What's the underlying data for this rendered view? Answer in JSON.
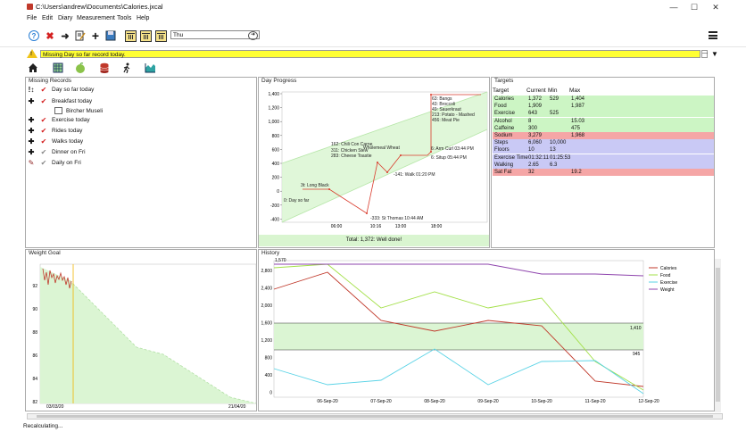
{
  "window": {
    "title": "C:\\Users\\andrew\\Documents\\Calories.jxcal",
    "minimize": "—",
    "maximize": "☐",
    "close": "✕"
  },
  "menu": [
    "File",
    "Edit",
    "Diary",
    "Measurement",
    "Tools",
    "Help"
  ],
  "toolbar": {
    "day_field": "Thu",
    "go_icon": "arrow-right-circle-icon"
  },
  "warning": {
    "text": "Missing Day so far record today."
  },
  "missing_records": {
    "title": "Missing Records",
    "items": [
      {
        "icon": "exclamation-icon",
        "label": "Day so far today"
      },
      {
        "icon": "plus-icon",
        "label": "Breakfast today"
      },
      {
        "icon": "plus-icon",
        "label": "Exercise today"
      },
      {
        "icon": "plus-icon",
        "label": "Rides today"
      },
      {
        "icon": "plus-icon",
        "label": "Walks today"
      },
      {
        "icon": "plus-icon",
        "label": "Dinner on Fri"
      },
      {
        "icon": "edit-icon",
        "label": "Daily on Fri"
      }
    ],
    "subitem": "Bircher Museli"
  },
  "day_progress": {
    "title": "Day Progress",
    "total_text": "Total: 1,372: Well done!",
    "yticks": [
      "1,400",
      "1,200",
      "1,000",
      "800",
      "600",
      "400",
      "200",
      "0",
      "-200",
      "-400"
    ],
    "xticks": [
      "06:00",
      "10:16",
      "13:00",
      "18:00"
    ],
    "annotations": [
      "0: Day so far",
      "3t: Long Black",
      "162: Chili Con Carne",
      "311: Chicken Stew",
      "283: Cheese Toastie",
      "Wholemeal Wheat",
      "-333: St Thomas 10:44 AM",
      "-141: Walk 01:20 PM",
      "6: Arm Curl 03:44 PM",
      "6: Situp 05:44 PM",
      "63: Bangs",
      "43: Broccoli",
      "49: Sauerkraut",
      "213: Potato - Mashed",
      "456: Meat Pie"
    ]
  },
  "targets": {
    "title": "Targets",
    "headers": [
      "Target",
      "Current",
      "Min",
      "Max"
    ],
    "rows": [
      {
        "name": "Calories",
        "current": "1,372",
        "min": "529",
        "max": "1,404",
        "status": "ok"
      },
      {
        "name": "Food",
        "current": "1,909",
        "min": "",
        "max": "1,987",
        "status": "ok"
      },
      {
        "name": "Exercise",
        "current": "643",
        "min": "525",
        "max": "",
        "status": "ok"
      },
      {
        "name": "Alcohol",
        "current": "8",
        "min": "",
        "max": "15.03",
        "status": "ok"
      },
      {
        "name": "Caffeine",
        "current": "300",
        "min": "",
        "max": "475",
        "status": "ok"
      },
      {
        "name": "Sodium",
        "current": "3,279",
        "min": "",
        "max": "1,968",
        "status": "over"
      },
      {
        "name": "Steps",
        "current": "6,060",
        "min": "10,000",
        "max": "",
        "status": "under"
      },
      {
        "name": "Floors",
        "current": "10",
        "min": "13",
        "max": "",
        "status": "under"
      },
      {
        "name": "Exercise Time",
        "current": "01:32:11",
        "min": "01:25:53",
        "max": "",
        "status": "under"
      },
      {
        "name": "Walking",
        "current": "2.65",
        "min": "6.3",
        "max": "",
        "status": "under"
      },
      {
        "name": "Sat Fat",
        "current": "32",
        "min": "",
        "max": "19.2",
        "status": "over"
      }
    ],
    "colors": {
      "ok": "#ccf5c4",
      "over": "#f5a6a6",
      "under": "#c9c9f5"
    }
  },
  "weight_goal": {
    "title": "Weight Goal",
    "yticks": [
      "92",
      "90",
      "88",
      "86",
      "84",
      "82"
    ],
    "xticks": [
      "03/03/20",
      "21/04/20"
    ]
  },
  "history": {
    "title": "History",
    "yticks": [
      "2,800",
      "2,400",
      "2,000",
      "1,600",
      "1,200",
      "800",
      "400",
      "0"
    ],
    "top_label": "1,570",
    "xticks": [
      "06-Sep-20",
      "07-Sep-20",
      "08-Sep-20",
      "09-Sep-20",
      "10-Sep-20",
      "11-Sep-20",
      "12-Sep-20"
    ],
    "band_labels": [
      "1,410",
      "945"
    ],
    "legend": [
      {
        "name": "Calories",
        "color": "#c0392b"
      },
      {
        "name": "Food",
        "color": "#a3e048"
      },
      {
        "name": "Exercise",
        "color": "#5ad3e6"
      },
      {
        "name": "Weight",
        "color": "#8e44ad"
      }
    ]
  },
  "status": {
    "text": "Recalculating..."
  }
}
